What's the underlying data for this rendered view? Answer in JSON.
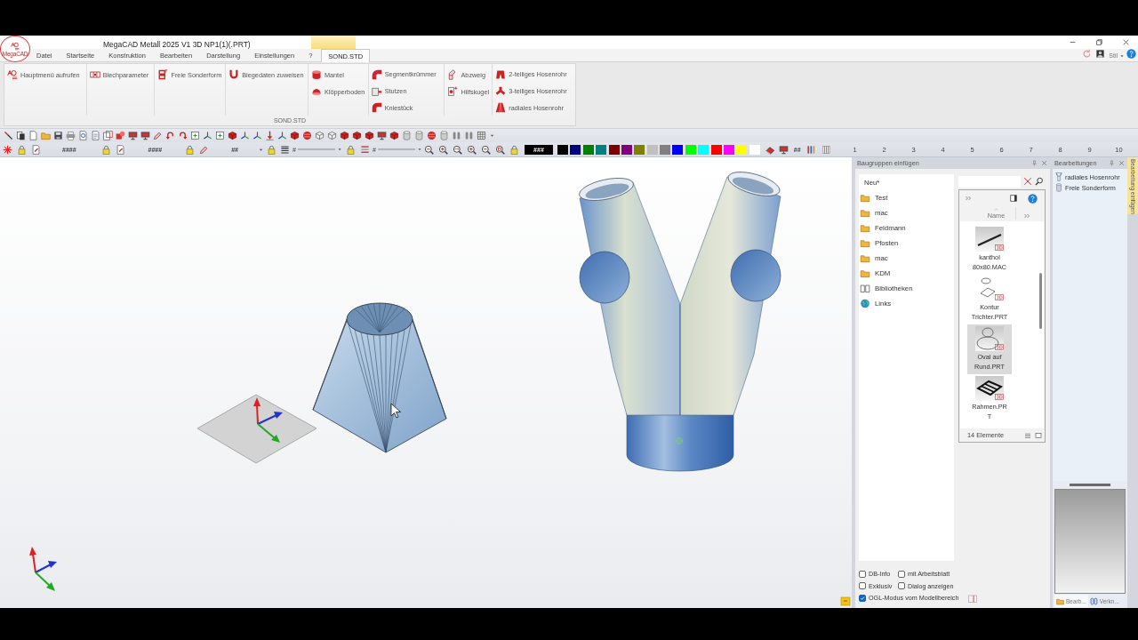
{
  "app": {
    "logo_text": "MegaCAD",
    "title": "MegaCAD Metall 2025 V1 3D NP1(1)(.PRT)"
  },
  "menu": [
    {
      "label": "Datei",
      "selected": false
    },
    {
      "label": "Startseite",
      "selected": false
    },
    {
      "label": "Konstruktion",
      "selected": false
    },
    {
      "label": "Bearbeiten",
      "selected": false
    },
    {
      "label": "Darstellung",
      "selected": false
    },
    {
      "label": "Einstellungen",
      "selected": false
    },
    {
      "label": "?",
      "selected": false
    },
    {
      "label": "SOND.STD",
      "selected": true
    }
  ],
  "style_menu": {
    "label": "Stil"
  },
  "ribbon": {
    "groups": [
      {
        "buttons": [
          {
            "label": "Hauptmenü aufrufen"
          }
        ]
      },
      {
        "buttons": [
          {
            "label": "Blechparameter"
          }
        ]
      },
      {
        "buttons": [
          {
            "label": "Freie Sonderform"
          }
        ]
      },
      {
        "buttons": [
          {
            "label": "Biegedaten zuweisen"
          }
        ]
      },
      {
        "buttons": [
          {
            "label": "Mantel"
          },
          {
            "label": "Klöpperboden"
          }
        ]
      },
      {
        "buttons": [
          {
            "label": "Segmentkrümmer"
          },
          {
            "label": "Stutzen"
          },
          {
            "label": "Kniestück"
          }
        ]
      },
      {
        "buttons": [
          {
            "label": "Abzweig"
          },
          {
            "label": "Hilfskugel"
          }
        ]
      },
      {
        "buttons": [
          {
            "label": "2-teiliges Hosenrohr"
          },
          {
            "label": "3-teiliges Hosenrohr"
          },
          {
            "label": "radiales Hosenrohr"
          }
        ]
      }
    ],
    "title": "SOND.STD"
  },
  "format_bar": {
    "fields": [
      "####",
      "####",
      "##"
    ],
    "line_styles": [
      "#",
      "#"
    ],
    "color_field": "###",
    "swatches": [
      {
        "color": "#000000"
      },
      {
        "color": "#000080"
      },
      {
        "color": "#008000"
      },
      {
        "color": "#008080"
      },
      {
        "color": "#800000"
      },
      {
        "color": "#800080"
      },
      {
        "color": "#808000"
      },
      {
        "color": "#c0c0c0"
      },
      {
        "color": "#808080"
      },
      {
        "color": "#0000ff"
      },
      {
        "color": "#00ff00"
      },
      {
        "color": "#00ffff"
      },
      {
        "color": "#ff0000"
      },
      {
        "color": "#ff00ff"
      },
      {
        "color": "#ffff00"
      },
      {
        "color": "#ffffff"
      }
    ],
    "grid_field": "##",
    "numbers": [
      "1",
      "2",
      "3",
      "4",
      "5",
      "6",
      "7",
      "8",
      "9",
      "10"
    ]
  },
  "assembly_panel": {
    "title": "Baugruppen einfügen",
    "tree": [
      {
        "label": "Neu*",
        "kind": "new"
      },
      {
        "label": "Test",
        "kind": "folder"
      },
      {
        "label": "mac",
        "kind": "folder"
      },
      {
        "label": "Feldmann",
        "kind": "folder"
      },
      {
        "label": "Pfosten",
        "kind": "folder"
      },
      {
        "label": "mac",
        "kind": "folder"
      },
      {
        "label": "KDM",
        "kind": "folder"
      },
      {
        "label": "Bibliotheken",
        "kind": "library"
      },
      {
        "label": "Links",
        "kind": "web"
      }
    ],
    "files": {
      "column": "Name",
      "items": [
        {
          "name": "kanthol 80x80.MAC",
          "kind": "bar",
          "selected": false
        },
        {
          "name": "Kontur Trichter.PRT",
          "kind": "outline",
          "selected": false
        },
        {
          "name": "Oval auf Rund.PRT",
          "kind": "ovals",
          "selected": true
        },
        {
          "name": "Rahmen.PRT",
          "kind": "frame",
          "selected": false
        }
      ],
      "count": "14 Elemente"
    },
    "options": [
      {
        "label": "DB-Info",
        "checked": false
      },
      {
        "label": "mit Arbeitsblatt",
        "checked": false
      },
      {
        "label": "Exklusiv",
        "checked": false
      },
      {
        "label": "Dialog anzeigen",
        "checked": false
      },
      {
        "label": "OGL-Modus vom Modellbereich",
        "checked": true
      }
    ]
  },
  "operations_panel": {
    "title": "Bearbeitungen",
    "items": [
      {
        "label": "radiales Hosenrohr"
      },
      {
        "label": "Freie Sonderform"
      }
    ],
    "tabs": [
      {
        "label": "Bearb...",
        "selected": true
      },
      {
        "label": "Verkn...",
        "selected": false
      }
    ]
  },
  "side_tab": {
    "label": "Bearbeitung einfügen"
  }
}
